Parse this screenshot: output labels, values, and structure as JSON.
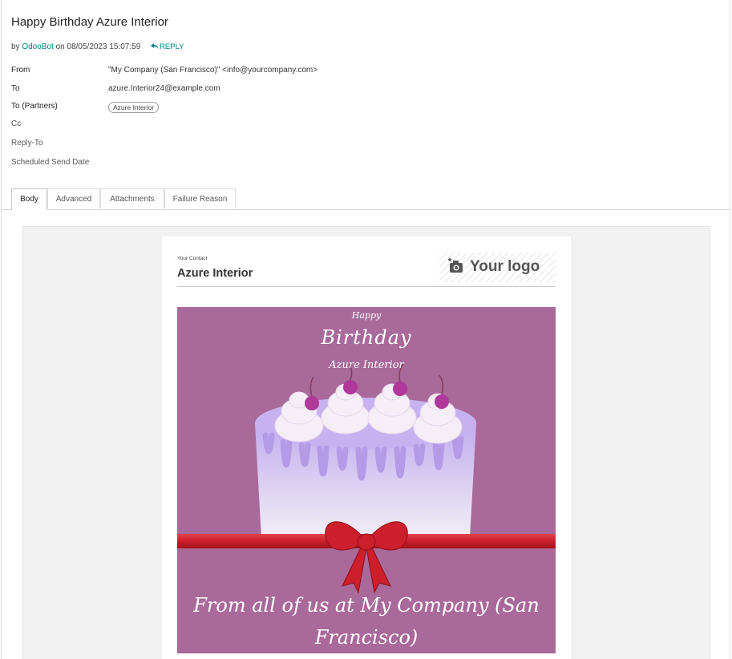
{
  "message": {
    "subject": "Happy Birthday Azure Interior",
    "by_prefix": "by",
    "author": "OdooBot",
    "date_text": "on 08/05/2023 15:07:59",
    "reply_label": "REPLY"
  },
  "fields": {
    "from": {
      "label": "From",
      "value": "\"My Company (San Francisco)\" <info@yourcompany.com>"
    },
    "to": {
      "label": "To",
      "value": "azure.Interior24@example.com"
    },
    "to_partners": {
      "label": "To (Partners)",
      "tag": "Azure Interior"
    },
    "cc": {
      "label": "Cc"
    },
    "reply_to": {
      "label": "Reply-To"
    },
    "scheduled": {
      "label": "Scheduled Send Date"
    }
  },
  "tabs": [
    {
      "label": "Body",
      "active": true
    },
    {
      "label": "Advanced",
      "active": false
    },
    {
      "label": "Attachments",
      "active": false
    },
    {
      "label": "Failure Reason",
      "active": false
    }
  ],
  "email_body": {
    "contact_label": "Your Contact",
    "contact_name": "Azure Interior",
    "logo_text": "Your logo",
    "greeting_small": "Happy",
    "greeting_large": "Birthday",
    "recipient": "Azure Interior",
    "footer": "From all of us at My Company (San Francisco)"
  },
  "colors": {
    "accent": "#017e84",
    "hero_bg": "#a9699b",
    "ribbon": "#d62a35",
    "frosting": "#b7a2e6"
  },
  "icons": {
    "reply": "reply-arrow-icon",
    "logo": "camera-plus-icon",
    "hero": "birthday-cake-icon"
  }
}
